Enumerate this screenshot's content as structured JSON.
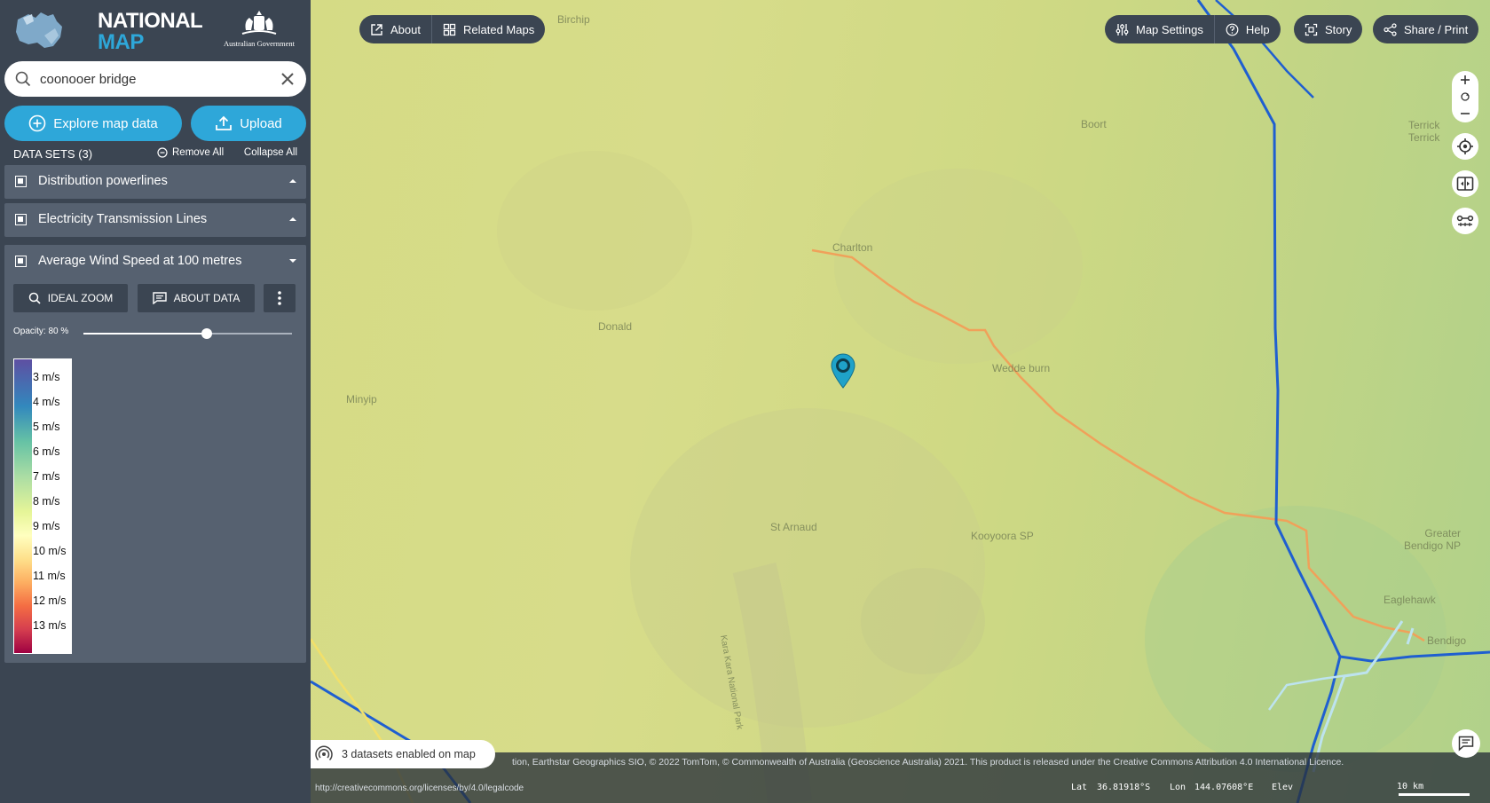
{
  "brand": {
    "line1": "NATIONAL",
    "line2": "MAP",
    "gov_label": "Australian Government"
  },
  "search": {
    "value": "coonooer bridge"
  },
  "buttons": {
    "explore": "Explore map data",
    "upload": "Upload"
  },
  "datasets": {
    "title": "DATA SETS (3)",
    "remove_all": "Remove All",
    "collapse_all": "Collapse All",
    "items": [
      {
        "label": "Distribution powerlines"
      },
      {
        "label": "Electricity Transmission Lines"
      },
      {
        "label": "Average Wind Speed at 100 metres"
      }
    ]
  },
  "expanded": {
    "ideal_zoom": "IDEAL ZOOM",
    "about_data": "ABOUT DATA",
    "opacity_label": "Opacity: 80 %",
    "opacity": 0.8
  },
  "legend": {
    "ticks": [
      "3 m/s",
      "4 m/s",
      "5 m/s",
      "6 m/s",
      "7 m/s",
      "8 m/s",
      "9 m/s",
      "10 m/s",
      "11 m/s",
      "12 m/s",
      "13 m/s"
    ]
  },
  "toolbar": {
    "about": "About",
    "related_maps": "Related Maps",
    "map_settings": "Map Settings",
    "help": "Help",
    "story": "Story",
    "share_print": "Share / Print"
  },
  "places": {
    "birchip": "Birchip",
    "boort": "Boort",
    "terrick": "Terrick\nTerrick",
    "charlton": "Charlton",
    "donald": "Donald",
    "minyip": "Minyip",
    "wedderburn": "Wedde burn",
    "st_arnaud": "St Arnaud",
    "kooyoora": "Kooyoora SP",
    "greater_bendigo": "Greater\nBendigo NP",
    "eaglehawk": "Eaglehawk",
    "bendigo": "Bendigo",
    "kara_kara": "Kara Kara National Park"
  },
  "status": {
    "datasets_enabled": "3 datasets enabled on map",
    "attribution": "tion, Earthstar Geographics SIO, © 2022 TomTom, © Commonwealth of Australia (Geoscience Australia) 2021. This product is released under the Creative Commons Attribution 4.0 International Licence.",
    "license_url": "http://creativecommons.org/licenses/by/4.0/legalcode",
    "lat_label": "Lat",
    "lat": "36.81918°S",
    "lon_label": "Lon",
    "lon": "144.07608°E",
    "elev_label": "Elev",
    "scale": "10 km"
  },
  "colors": {
    "sidebar_bg": "#3b4552",
    "accent": "#2ea7d9",
    "transmission_line": "#1f5fd0",
    "distribution_line": "#f0a15a",
    "marker": "#1fa2c9"
  }
}
